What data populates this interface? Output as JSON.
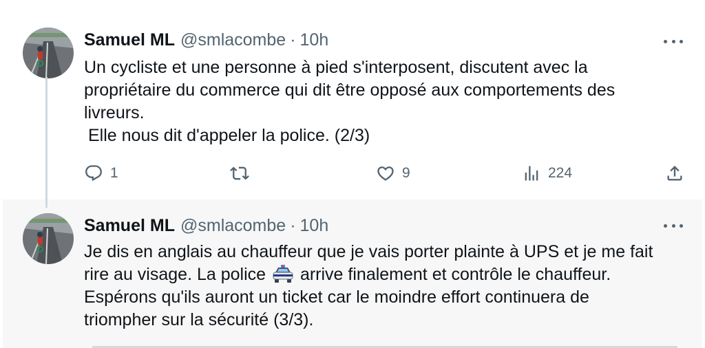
{
  "tweets": [
    {
      "name": "Samuel ML",
      "handle": "@smlacombe",
      "separator": "·",
      "time": "10h",
      "text_lines": [
        "Un cycliste et une personne à pied s'interposent, discutent avec la",
        "propriétaire du commerce qui dit être opposé aux comportements des",
        "livreurs.",
        "Elle nous dit d'appeler la police. (2/3)"
      ],
      "actions": {
        "reply_count": "1",
        "retweet_count": "",
        "like_count": "9",
        "views_count": "224"
      }
    },
    {
      "name": "Samuel ML",
      "handle": "@smlacombe",
      "separator": "·",
      "time": "10h",
      "text_lines": [
        "Je dis en anglais au chauffeur que je vais porter plainte à UPS et je me fait",
        "rire au visage.  La police",
        "arrive finalement et contrôle le chauffeur.",
        "Espérons qu'ils auront un ticket car le moindre effort continuera de",
        "triompher sur la sécurité (3/3)."
      ],
      "emoji": "police-car-icon"
    }
  ],
  "colors": {
    "text": "#0f1419",
    "secondary": "#536471",
    "thread_line": "#cfd9de",
    "hover_bg": "#f7f7f7"
  }
}
